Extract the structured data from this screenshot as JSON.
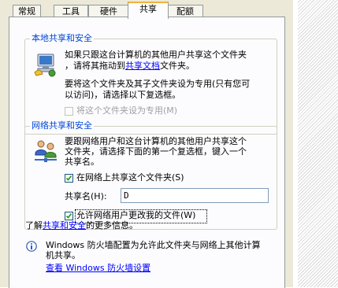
{
  "tabs": [
    "常规",
    "工具",
    "硬件",
    "共享",
    "配额"
  ],
  "local_group": {
    "legend": "本地共享和安全",
    "line1": "如果只跟这台计算机的其他用户共享这个文件夹",
    "line2_pre": "，请将其拖动到",
    "line2_link": "共享文档",
    "line2_post": "文件夹。",
    "line3": "要将这个文件夹及其子文件夹设为专用(只有您可",
    "line4": "以访问)，请选择以下复选框。",
    "private_checkbox_label": "将这个文件夹设为专用(M)",
    "private_checked": false
  },
  "network_group": {
    "legend": "网络共享和安全",
    "line1": "要跟网络用户和这台计算机的其他用户共享这个",
    "line2": "文件夹，请选择下面的第一个复选框，键入一个",
    "line3": "共享名。",
    "share_checkbox_label": "在网络上共享这个文件夹(S)",
    "share_checked": true,
    "share_name_label": "共享名(H):",
    "share_name_value": "D",
    "allow_change_label": "允许网络用户更改我的文件(W)",
    "allow_change_checked": true
  },
  "learn_more": {
    "pre": "了解",
    "link": "共享和安全",
    "post": "的更多信息。"
  },
  "firewall": {
    "line1": "Windows 防火墙配置为允许此文件夹与网络上其他计算",
    "line2": "机共享。",
    "link": "查看 Windows 防火墙设置"
  },
  "icons": [
    "computer-share-icon",
    "network-users-icon",
    "info-icon"
  ]
}
